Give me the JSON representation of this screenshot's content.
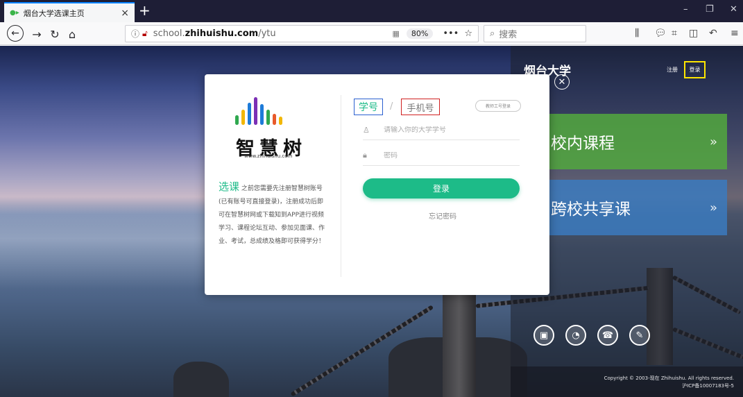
{
  "browser": {
    "tab_title": "烟台大学选课主页",
    "tab_close": "×",
    "new_tab": "+",
    "window_min": "–",
    "window_max": "❐",
    "window_close": "✕",
    "url_prefix": "school.",
    "url_domain": "zhihuishu.com",
    "url_path": "/ytu",
    "zoom": "80%",
    "more": "•••",
    "search_placeholder": "搜索"
  },
  "header": {
    "school_name": "烟台大学",
    "register": "注册",
    "login": "登录"
  },
  "courses": {
    "inner": {
      "label": "校内课程",
      "arrow": "»",
      "color": "#52a83e"
    },
    "cross": {
      "label": "跨校共享课",
      "arrow": "»",
      "color": "#3b7abe"
    }
  },
  "footer": {
    "copyright_line1": "Copyright © 2003-现在 Zhihuishu. All rights reserved.",
    "copyright_line2": "沪ICP备10007183号-5"
  },
  "login_modal": {
    "logo_text": "智慧树",
    "logo_url": "www.zhihuishu.com",
    "intro_highlight": "选课",
    "intro_text": "之前您需要先注册智慧树账号(已有账号可直接登录)，注册成功后即可在智慧树网或下载知到APP进行视频学习、课程论坛互动、参加见面课、作业、考试，总成绩及格即可获得学分！",
    "tab_student_id": "学号",
    "tab_separator": "/",
    "tab_phone": "手机号",
    "teacher_login": "教师工号登录",
    "username_placeholder": "请输入你的大学学号",
    "password_placeholder": "密码",
    "login_button": "登录",
    "forgot_password": "忘记密码",
    "brand_color": "#1dbb88"
  }
}
